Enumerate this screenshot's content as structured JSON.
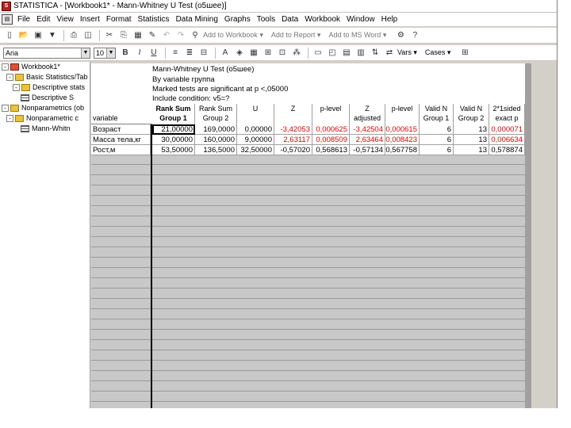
{
  "window": {
    "title": "STATISTICA - [Workbook1* - Mann-Whitney U Test (o5шее)]"
  },
  "menu": [
    "File",
    "Edit",
    "View",
    "Insert",
    "Format",
    "Statistics",
    "Data Mining",
    "Graphs",
    "Tools",
    "Data",
    "Workbook",
    "Window",
    "Help"
  ],
  "toolbar1": {
    "add_to_workbook": "Add to Workbook ▾",
    "add_to_report": "Add to Report ▾",
    "add_to_msword": "Add to MS Word ▾"
  },
  "toolbar2": {
    "font": "Aria",
    "size": "10",
    "bold": "B",
    "italic": "I",
    "underline": "U",
    "vars": "Vars ▾",
    "cases": "Cases ▾"
  },
  "tree": {
    "items": [
      {
        "label": "Workbook1*",
        "level": 0,
        "icon": "folder-red",
        "glyph": "-"
      },
      {
        "label": "Basic Statistics/Tab",
        "level": 1,
        "icon": "folder",
        "glyph": "-"
      },
      {
        "label": "Descriptive stats",
        "level": 2,
        "icon": "folder",
        "glyph": "-"
      },
      {
        "label": "Descriptive S",
        "level": 3,
        "icon": "sheet",
        "glyph": ""
      },
      {
        "label": "Nonparametrics (ob",
        "level": 0,
        "icon": "folder",
        "glyph": "-"
      },
      {
        "label": "Nonparametric c",
        "level": 1,
        "icon": "folder",
        "glyph": "-"
      },
      {
        "label": "Mann-Whitn",
        "level": 3,
        "icon": "sheet",
        "glyph": ""
      }
    ]
  },
  "sheet": {
    "header_lines": [
      "Mann-Whitney U Test (o5шее)",
      "By variable группа",
      "Marked tests are significant at p <,05000",
      "Include condition: v5=?"
    ],
    "variable_label": "variable",
    "columns": [
      {
        "l1": "Rank Sum",
        "l2": "Group 1",
        "bold": true
      },
      {
        "l1": "Rank Sum",
        "l2": "Group 2",
        "bold": false
      },
      {
        "l1": "U",
        "l2": "",
        "bold": false
      },
      {
        "l1": "Z",
        "l2": "",
        "bold": false
      },
      {
        "l1": "p-level",
        "l2": "",
        "bold": false
      },
      {
        "l1": "Z",
        "l2": "adjusted",
        "bold": false
      },
      {
        "l1": "p-level",
        "l2": "",
        "bold": false
      },
      {
        "l1": "Valid N",
        "l2": "Group 1",
        "bold": false
      },
      {
        "l1": "Valid N",
        "l2": "Group 2",
        "bold": false
      },
      {
        "l1": "2*1sided",
        "l2": "exact p",
        "bold": false
      }
    ],
    "rows": [
      {
        "name": "Возраст",
        "red": true,
        "cells": [
          "21,00000",
          "169,0000",
          "0,00000",
          "-3,42053",
          "0,000625",
          "-3,42504",
          "0,000615",
          "6",
          "13",
          "0,000071"
        ]
      },
      {
        "name": "Масса тела,кг",
        "red": true,
        "cells": [
          "30,00000",
          "160,0000",
          "9,00000",
          "2,63117",
          "0,008509",
          "2,63464",
          "0,008423",
          "6",
          "13",
          "0,006634"
        ]
      },
      {
        "name": "Рост,м",
        "red": false,
        "cells": [
          "53,50000",
          "136,5000",
          "32,50000",
          "-0,57020",
          "0,568613",
          "-0,57134",
          "0,567758",
          "6",
          "13",
          "0,578874"
        ]
      }
    ]
  }
}
